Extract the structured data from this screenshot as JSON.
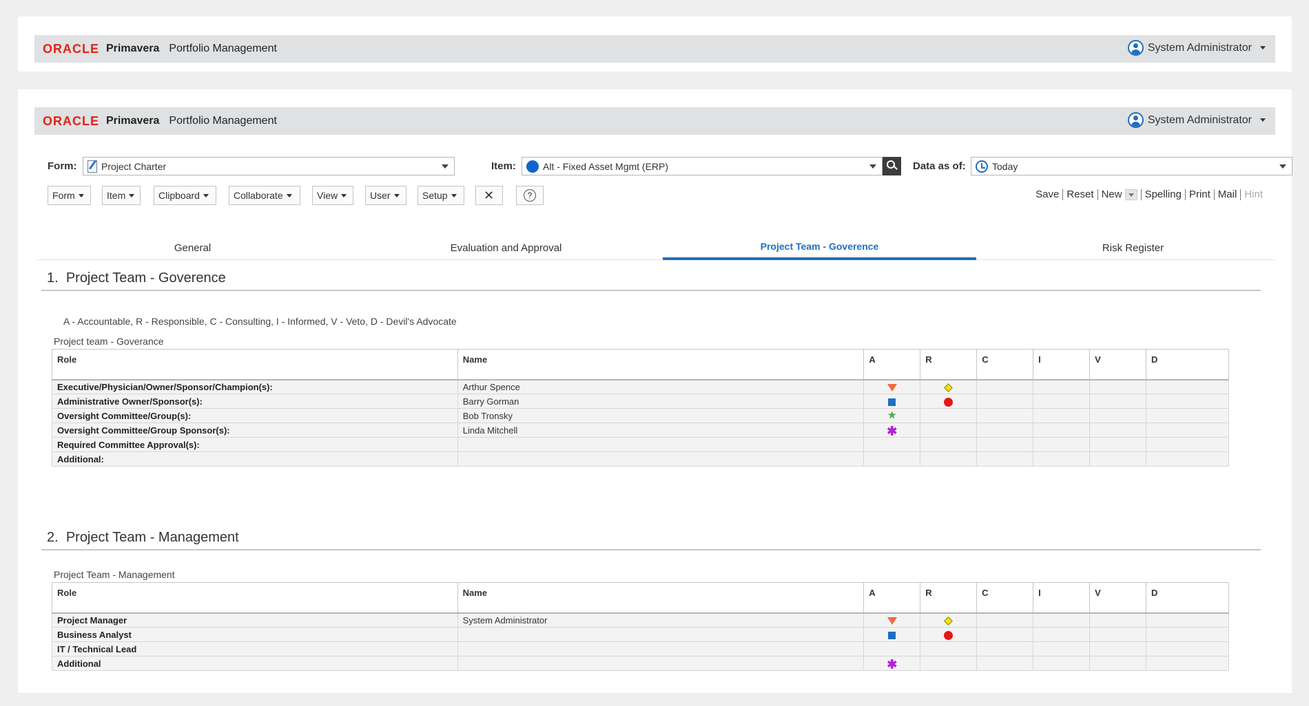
{
  "app": {
    "brand_oracle": "ORACLE",
    "brand_primavera": "Primavera",
    "brand_product": "Portfolio Management",
    "user": "System Administrator"
  },
  "form_bar": {
    "form_label": "Form:",
    "form_value": "Project Charter",
    "item_label": "Item:",
    "item_value": "Alt - Fixed Asset Mgmt (ERP)",
    "data_label": "Data as of:",
    "data_value": "Today"
  },
  "toolbar": {
    "menus": [
      "Form",
      "Item",
      "Clipboard",
      "Collaborate",
      "View",
      "User",
      "Setup"
    ],
    "actions": [
      "Save",
      "Reset",
      "New",
      "Spelling",
      "Print",
      "Mail",
      "Hint"
    ]
  },
  "tabs": [
    "General",
    "Evaluation and Approval",
    "Project Team - Goverence",
    "Risk Register"
  ],
  "active_tab": "Project Team - Goverence",
  "section1": {
    "number": "1.",
    "title": "Project Team - Goverence",
    "legend": "A - Accountable, R - Responsible, C - Consulting, I - Informed, V - Veto, D - Devil's Advocate",
    "table_label": "Project team - Goverance",
    "columns": [
      "Role",
      "Name",
      "A",
      "R",
      "C",
      "I",
      "V",
      "D"
    ],
    "rows": [
      {
        "role": "Executive/Physician/Owner/Sponsor/Champion(s):",
        "name": "Arthur Spence",
        "a": "triangle-down-orange",
        "r": "diamond-yellow"
      },
      {
        "role": "Administrative Owner/Sponsor(s):",
        "name": "Barry Gorman",
        "a": "square-blue",
        "r": "circle-red"
      },
      {
        "role": "Oversight Committee/Group(s):",
        "name": "Bob Tronsky",
        "a": "star-green",
        "r": ""
      },
      {
        "role": "Oversight Committee/Group Sponsor(s):",
        "name": "Linda Mitchell",
        "a": "asterisk-purple",
        "r": ""
      },
      {
        "role": "Required Committee Approval(s):",
        "name": "",
        "a": "",
        "r": ""
      },
      {
        "role": "Additional:",
        "name": "",
        "a": "",
        "r": ""
      }
    ]
  },
  "section2": {
    "number": "2.",
    "title": "Project Team - Management",
    "table_label": "Project Team - Management",
    "columns": [
      "Role",
      "Name",
      "A",
      "R",
      "C",
      "I",
      "V",
      "D"
    ],
    "rows": [
      {
        "role": "Project Manager",
        "name": "System Administrator",
        "a": "triangle-down-orange",
        "r": "diamond-yellow"
      },
      {
        "role": "Business Analyst",
        "name": "",
        "a": "square-blue",
        "r": "circle-red"
      },
      {
        "role": "IT / Technical Lead",
        "name": "",
        "a": "",
        "r": ""
      },
      {
        "role": "Additional",
        "name": "",
        "a": "asterisk-purple",
        "r": ""
      }
    ]
  }
}
